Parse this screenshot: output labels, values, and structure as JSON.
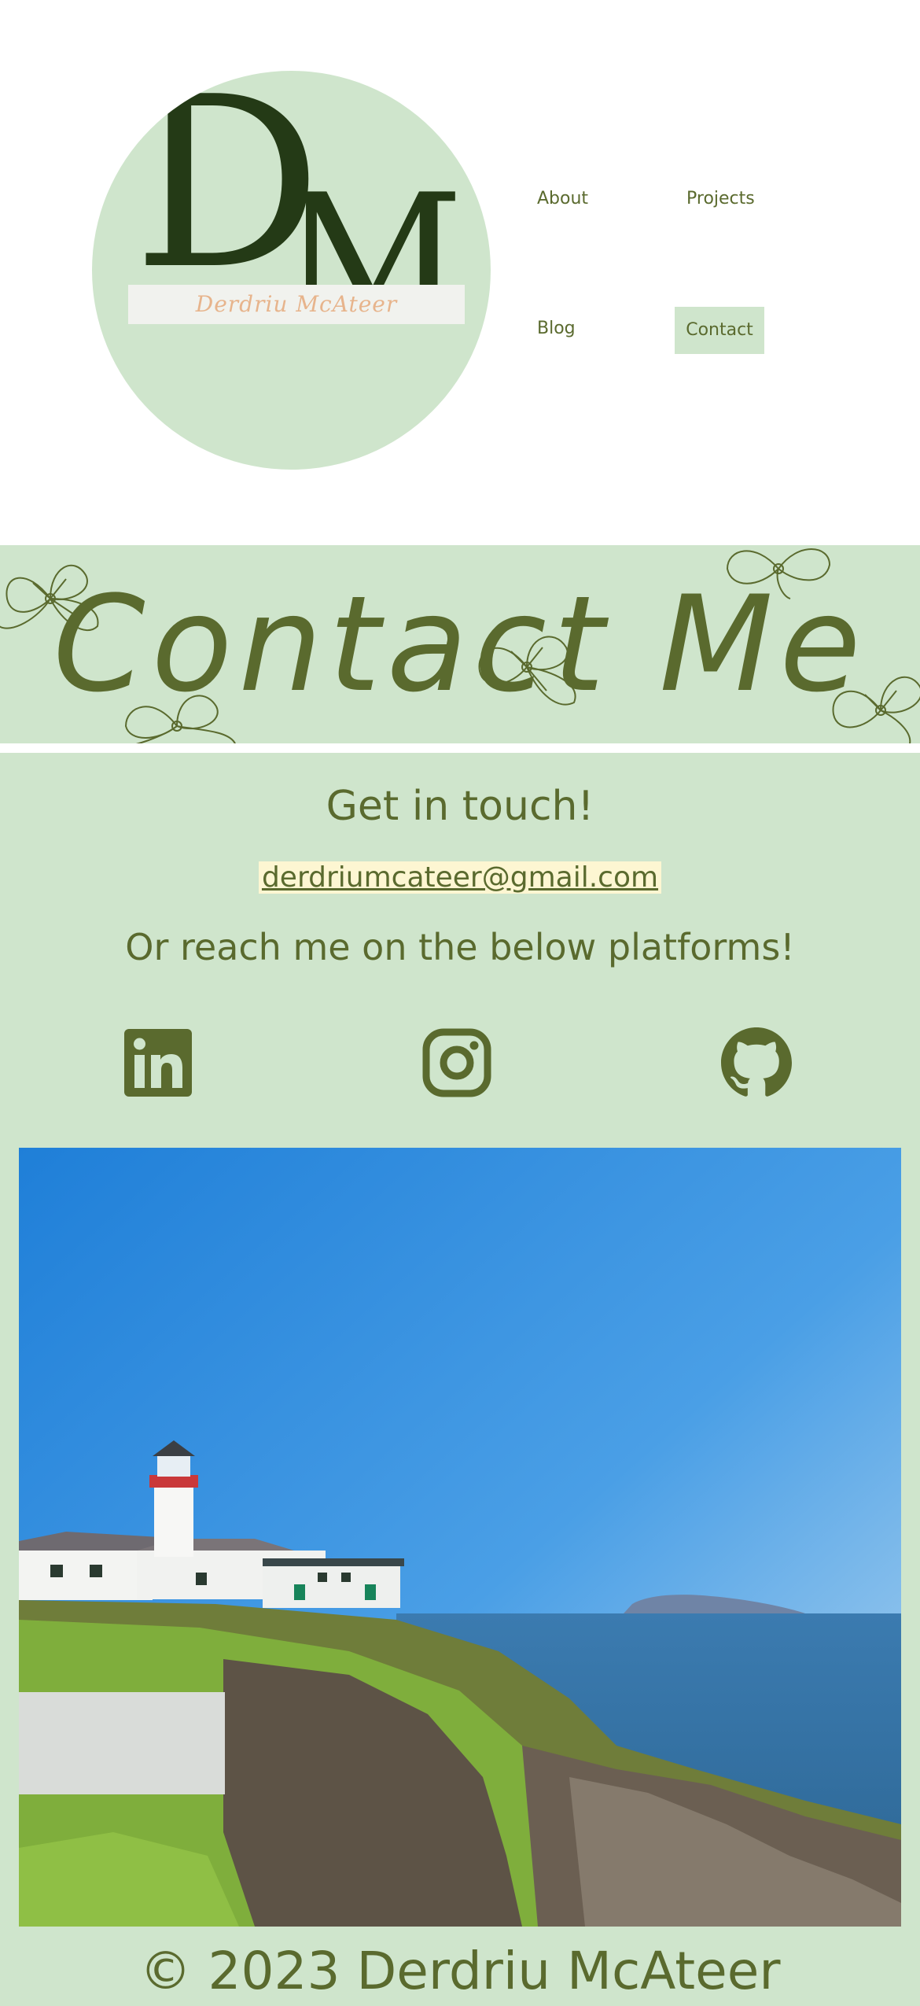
{
  "logo": {
    "letter_d": "D",
    "letter_m": "M",
    "script_name": "Derdriu McAteer"
  },
  "nav": {
    "about": "About",
    "projects": "Projects",
    "blog": "Blog",
    "contact": "Contact"
  },
  "banner": {
    "title": "Contact Me"
  },
  "contact": {
    "heading": "Get in touch!",
    "email": "derdriumcateer@gmail.com",
    "subheading": "Or reach me on the below platforms!",
    "socials": [
      {
        "icon": "linkedin-icon"
      },
      {
        "icon": "instagram-icon"
      },
      {
        "icon": "github-icon"
      }
    ]
  },
  "footer": {
    "text": "© 2023 Derdriu McAteer"
  },
  "colors": {
    "accent": "#5a6a2e",
    "mint": "#cfe5cc",
    "logo_dark": "#243a16",
    "email_highlight": "#fdf6d2"
  }
}
